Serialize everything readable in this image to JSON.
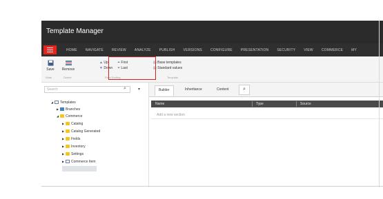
{
  "app": {
    "title": "Template Manager"
  },
  "tabs": [
    "HOME",
    "NAVIGATE",
    "REVIEW",
    "ANALYZE",
    "PUBLISH",
    "VERSIONS",
    "CONFIGURE",
    "PRESENTATION",
    "SECURITY",
    "VIEW",
    "COMMERCE",
    "MY"
  ],
  "ribbon": {
    "save": {
      "label": "Save",
      "sub": "Write"
    },
    "remove": {
      "label": "Remove",
      "sub": "Delete"
    },
    "up": "Up",
    "down": "Down",
    "first": "First",
    "last": "Last",
    "sorting_group": "Field Sorting",
    "base_templates": "Base templates",
    "standard_values": "Standard values",
    "template_group": "Template"
  },
  "left": {
    "search_placeholder": "Search"
  },
  "tree": [
    {
      "label": "Templates",
      "icon": "template-icon"
    },
    {
      "label": "Branches",
      "icon": "branch-icon"
    },
    {
      "label": "Commerce",
      "icon": "folder-icon"
    },
    {
      "label": "Catalog",
      "icon": "folder-icon"
    },
    {
      "label": "Catalog Generated",
      "icon": "folder-icon"
    },
    {
      "label": "Fields",
      "icon": "folder-icon"
    },
    {
      "label": "Inventory",
      "icon": "folder-icon"
    },
    {
      "label": "Settings",
      "icon": "folder-icon"
    },
    {
      "label": "Commerce Item",
      "icon": "template-icon"
    }
  ],
  "right": {
    "subtabs": [
      "Builder",
      "Inheritance",
      "Content"
    ],
    "columns": [
      "Name",
      "Type",
      "Source"
    ],
    "add_section": "Add a new section"
  },
  "colors": {
    "accent": "#e8231b",
    "titlebar": "#2b2b2b",
    "header": "#4a4a4a"
  }
}
